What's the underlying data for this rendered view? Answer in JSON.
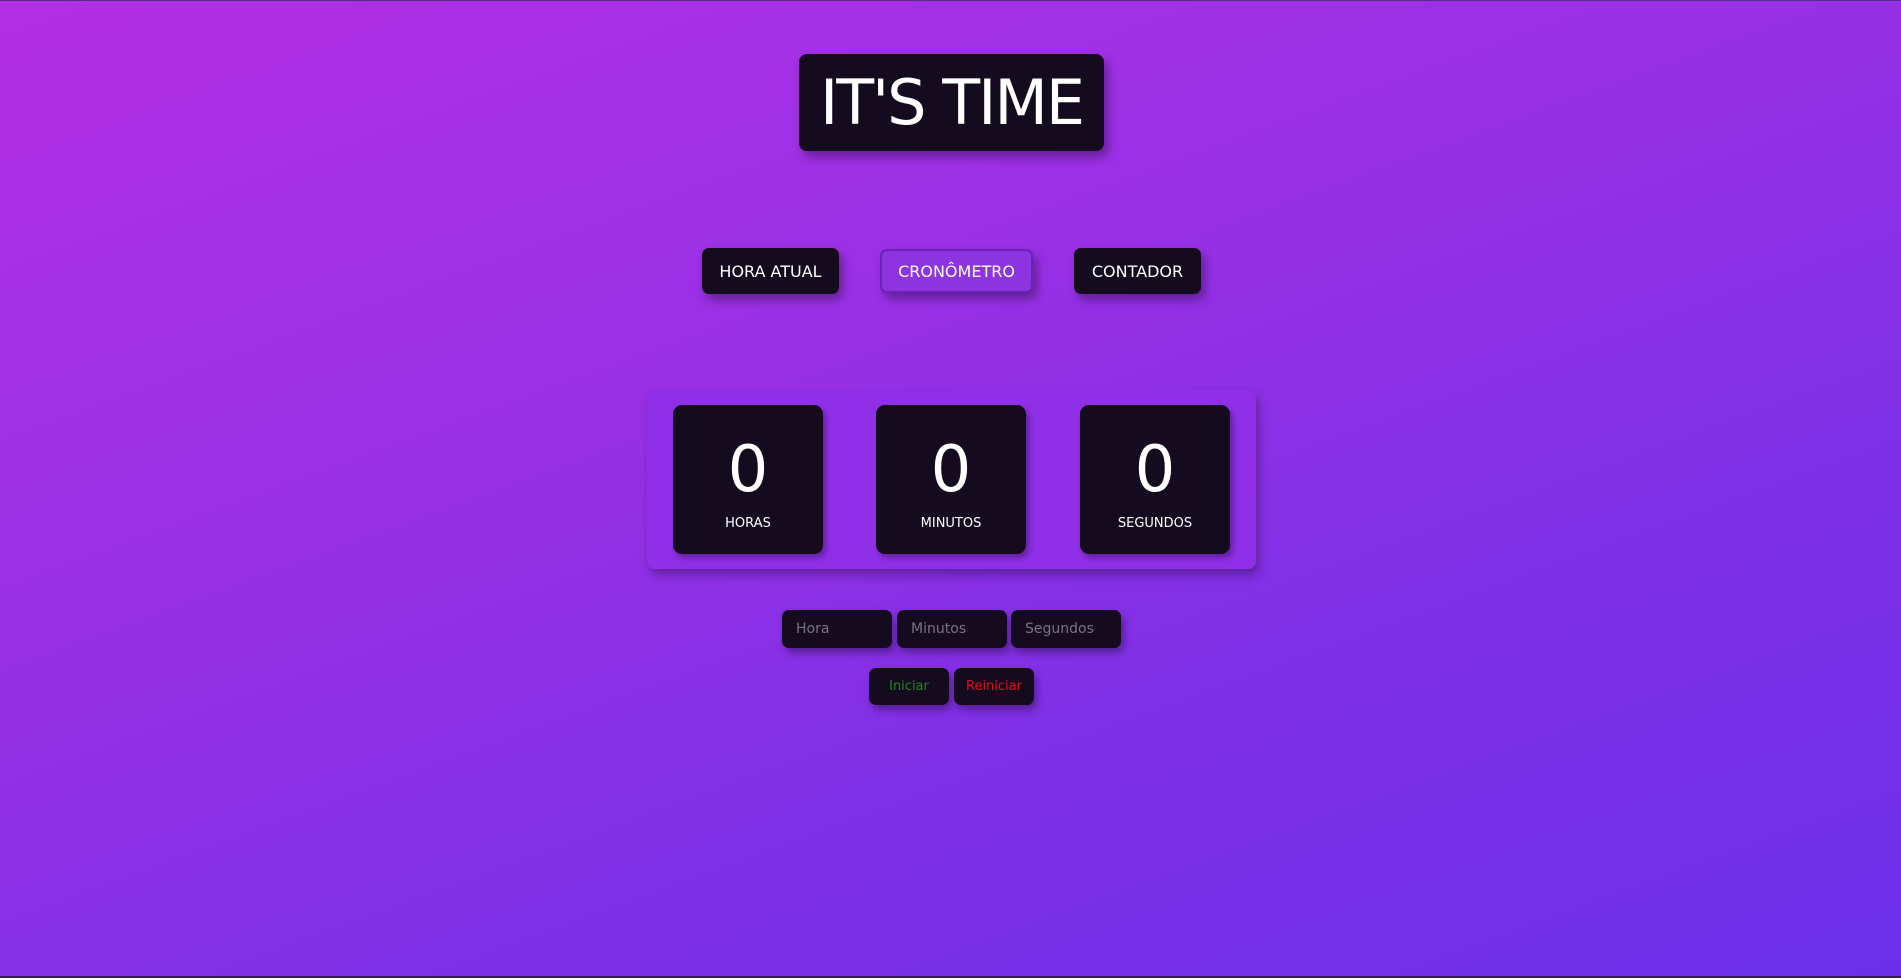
{
  "app": {
    "title": "IT'S TIME"
  },
  "nav": {
    "items": [
      {
        "label": "HORA ATUAL",
        "active": false
      },
      {
        "label": "CRONÔMETRO",
        "active": true
      },
      {
        "label": "CONTADOR",
        "active": false
      }
    ]
  },
  "clock": {
    "hours": {
      "value": "0",
      "unit": "HORAS"
    },
    "minutes": {
      "value": "0",
      "unit": "MINUTOS"
    },
    "seconds": {
      "value": "0",
      "unit": "SEGUNDOS"
    }
  },
  "inputs": {
    "hour": {
      "value": "",
      "placeholder": "Hora"
    },
    "minutes": {
      "value": "",
      "placeholder": "Minutos"
    },
    "seconds": {
      "value": "",
      "placeholder": "Segundos"
    }
  },
  "actions": {
    "start": {
      "label": "Iniciar",
      "color": "#1a8a1a"
    },
    "reset": {
      "label": "Reiniciar",
      "color": "#e0101a"
    }
  },
  "colors": {
    "background_start": "#b22fe6",
    "background_end": "#6a30e8",
    "card": "#150b1f",
    "active_tab": "#8b34e0"
  }
}
